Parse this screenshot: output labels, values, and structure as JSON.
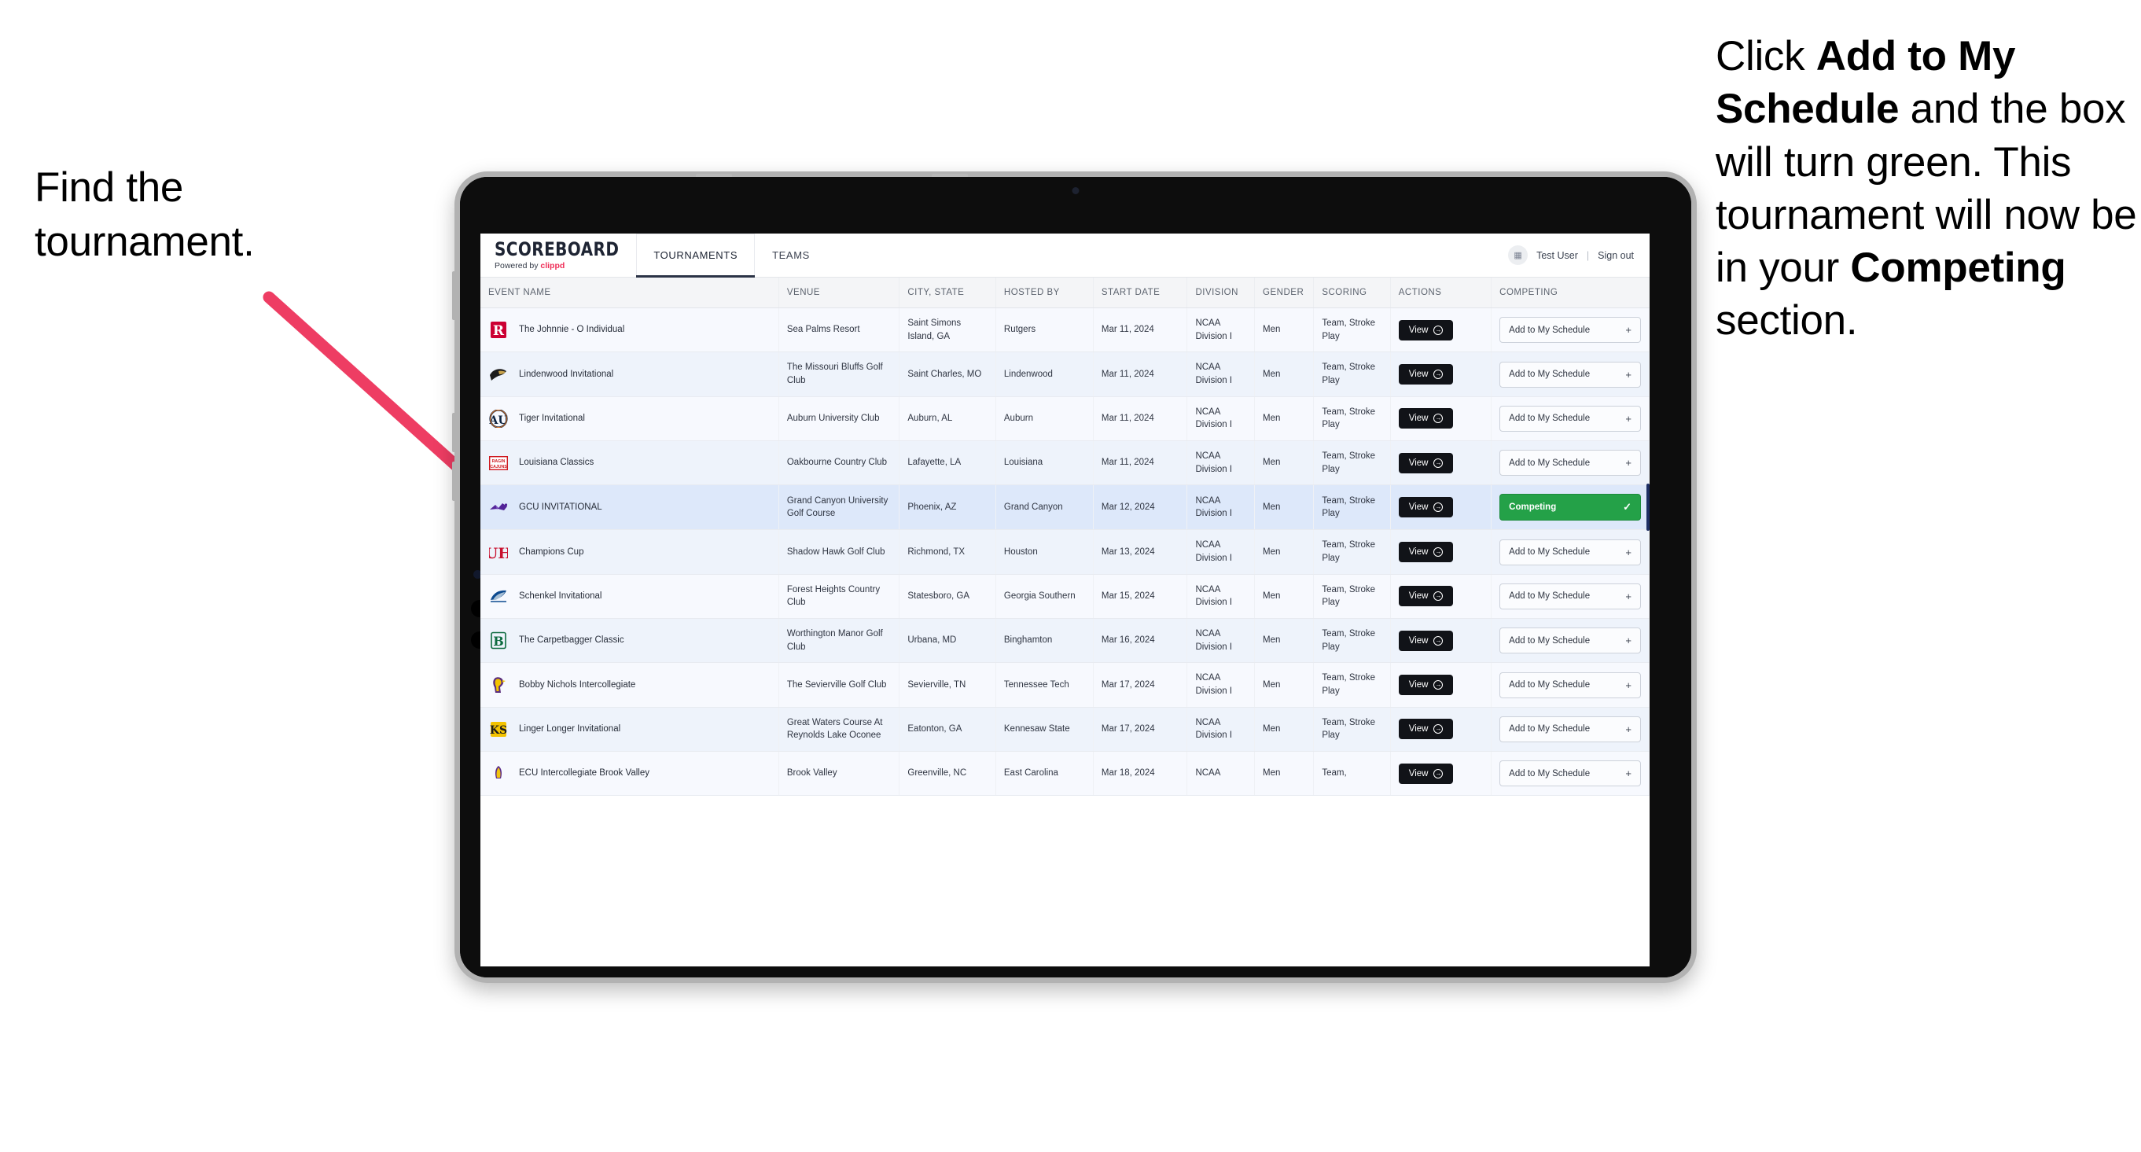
{
  "annotations": {
    "left": "Find the tournament.",
    "right_parts": [
      {
        "text": "Click ",
        "bold": false
      },
      {
        "text": "Add to My Schedule",
        "bold": true
      },
      {
        "text": " and the box will turn green. This tournament will now be in your ",
        "bold": false
      },
      {
        "text": "Competing",
        "bold": true
      },
      {
        "text": " section.",
        "bold": false
      }
    ],
    "arrow_color": "#ee3d63"
  },
  "app": {
    "brand": {
      "title": "SCOREBOARD",
      "powered_prefix": "Powered by ",
      "powered_brand": "clippd"
    },
    "tabs": [
      {
        "label": "TOURNAMENTS",
        "active": true
      },
      {
        "label": "TEAMS",
        "active": false
      }
    ],
    "user": {
      "avatar_icon": "user-avatar-icon",
      "name": "Test User",
      "separator": "|",
      "signout": "Sign out"
    },
    "columns": [
      "EVENT NAME",
      "VENUE",
      "CITY, STATE",
      "HOSTED BY",
      "START DATE",
      "DIVISION",
      "GENDER",
      "SCORING",
      "ACTIONS",
      "COMPETING"
    ],
    "buttons": {
      "view": "View",
      "view_icon": "arrow-right-circle-icon",
      "add": "Add to My Schedule",
      "add_icon": "plus-icon",
      "competing": "Competing",
      "competing_icon": "check-icon"
    },
    "colors": {
      "competing_green": "#24a148",
      "view_black": "#111318",
      "selected_row": "#dde8fa",
      "brand_pink": "#ef2e57"
    },
    "rows": [
      {
        "logo": "rutgers-logo",
        "event": "The Johnnie - O Individual",
        "venue": "Sea Palms Resort",
        "city": "Saint Simons Island, GA",
        "host": "Rutgers",
        "date": "Mar 11, 2024",
        "division": "NCAA Division I",
        "gender": "Men",
        "scoring": "Team, Stroke Play",
        "competing": false
      },
      {
        "logo": "lindenwood-logo",
        "event": "Lindenwood Invitational",
        "venue": "The Missouri Bluffs Golf Club",
        "city": "Saint Charles, MO",
        "host": "Lindenwood",
        "date": "Mar 11, 2024",
        "division": "NCAA Division I",
        "gender": "Men",
        "scoring": "Team, Stroke Play",
        "competing": false
      },
      {
        "logo": "auburn-logo",
        "event": "Tiger Invitational",
        "venue": "Auburn University Club",
        "city": "Auburn, AL",
        "host": "Auburn",
        "date": "Mar 11, 2024",
        "division": "NCAA Division I",
        "gender": "Men",
        "scoring": "Team, Stroke Play",
        "competing": false
      },
      {
        "logo": "louisiana-logo",
        "event": "Louisiana Classics",
        "venue": "Oakbourne Country Club",
        "city": "Lafayette, LA",
        "host": "Louisiana",
        "date": "Mar 11, 2024",
        "division": "NCAA Division I",
        "gender": "Men",
        "scoring": "Team, Stroke Play",
        "competing": false
      },
      {
        "logo": "gcu-logo",
        "event": "GCU INVITATIONAL",
        "venue": "Grand Canyon University Golf Course",
        "city": "Phoenix, AZ",
        "host": "Grand Canyon",
        "date": "Mar 12, 2024",
        "division": "NCAA Division I",
        "gender": "Men",
        "scoring": "Team, Stroke Play",
        "competing": true
      },
      {
        "logo": "houston-logo",
        "event": "Champions Cup",
        "venue": "Shadow Hawk Golf Club",
        "city": "Richmond, TX",
        "host": "Houston",
        "date": "Mar 13, 2024",
        "division": "NCAA Division I",
        "gender": "Men",
        "scoring": "Team, Stroke Play",
        "competing": false
      },
      {
        "logo": "georgia-southern-logo",
        "event": "Schenkel Invitational",
        "venue": "Forest Heights Country Club",
        "city": "Statesboro, GA",
        "host": "Georgia Southern",
        "date": "Mar 15, 2024",
        "division": "NCAA Division I",
        "gender": "Men",
        "scoring": "Team, Stroke Play",
        "competing": false
      },
      {
        "logo": "binghamton-logo",
        "event": "The Carpetbagger Classic",
        "venue": "Worthington Manor Golf Club",
        "city": "Urbana, MD",
        "host": "Binghamton",
        "date": "Mar 16, 2024",
        "division": "NCAA Division I",
        "gender": "Men",
        "scoring": "Team, Stroke Play",
        "competing": false
      },
      {
        "logo": "tennessee-tech-logo",
        "event": "Bobby Nichols Intercollegiate",
        "venue": "The Sevierville Golf Club",
        "city": "Sevierville, TN",
        "host": "Tennessee Tech",
        "date": "Mar 17, 2024",
        "division": "NCAA Division I",
        "gender": "Men",
        "scoring": "Team, Stroke Play",
        "competing": false
      },
      {
        "logo": "kennesaw-state-logo",
        "event": "Linger Longer Invitational",
        "venue": "Great Waters Course At Reynolds Lake Oconee",
        "city": "Eatonton, GA",
        "host": "Kennesaw State",
        "date": "Mar 17, 2024",
        "division": "NCAA Division I",
        "gender": "Men",
        "scoring": "Team, Stroke Play",
        "competing": false
      },
      {
        "logo": "east-carolina-logo",
        "event": "ECU Intercollegiate Brook Valley",
        "venue": "Brook Valley",
        "city": "Greenville, NC",
        "host": "East Carolina",
        "date": "Mar 18, 2024",
        "division": "NCAA",
        "gender": "Men",
        "scoring": "Team,",
        "competing": false
      }
    ]
  }
}
